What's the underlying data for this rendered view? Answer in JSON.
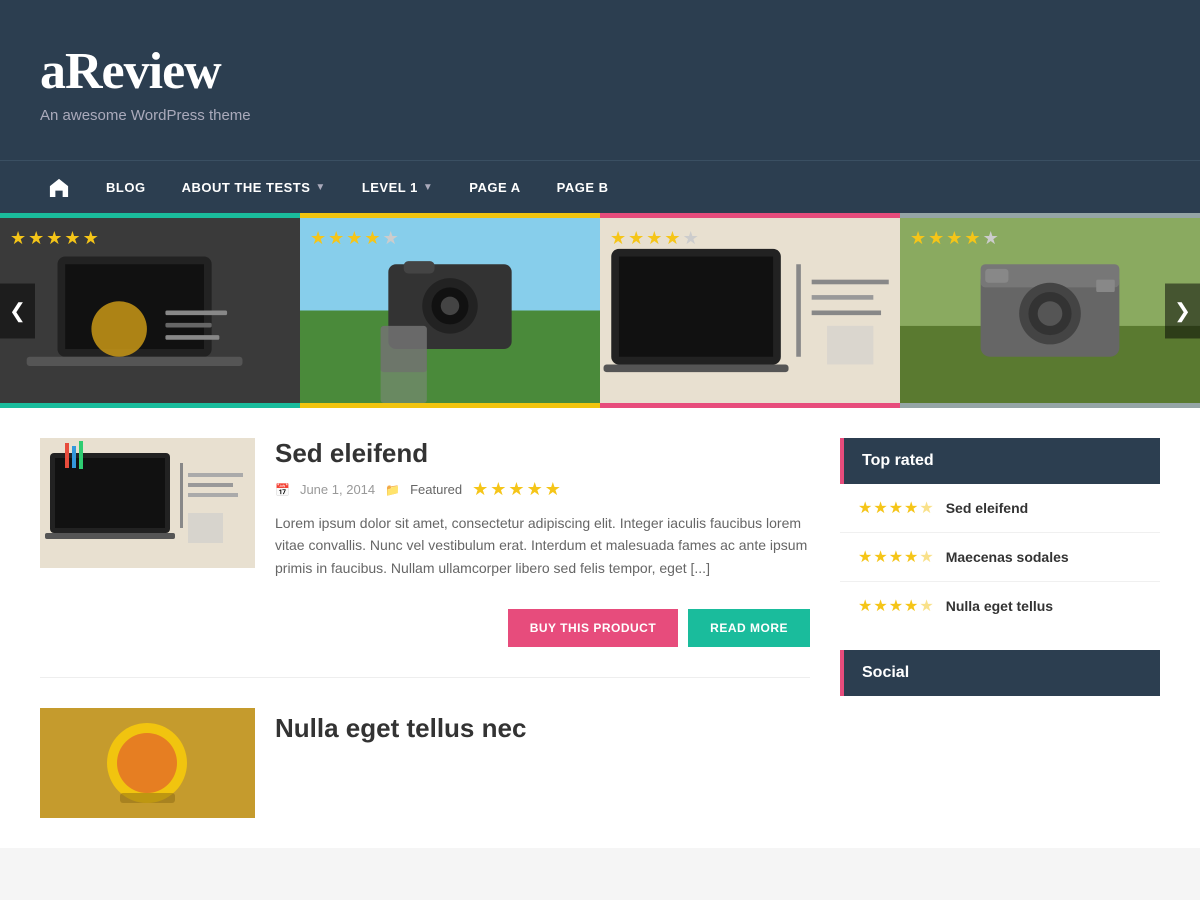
{
  "site": {
    "title": "aReview",
    "tagline": "An awesome WordPress theme"
  },
  "nav": {
    "home_label": "Home",
    "items": [
      {
        "id": "blog",
        "label": "BLOG",
        "has_dropdown": false
      },
      {
        "id": "about",
        "label": "ABOUT THE TESTS",
        "has_dropdown": true
      },
      {
        "id": "level1",
        "label": "LEVEL 1",
        "has_dropdown": true
      },
      {
        "id": "pagea",
        "label": "PAGE A",
        "has_dropdown": false
      },
      {
        "id": "pageb",
        "label": "PAGE B",
        "has_dropdown": false
      }
    ]
  },
  "carousel": {
    "prev_label": "❮",
    "next_label": "❯",
    "items": [
      {
        "id": "slide1",
        "stars": 4.5,
        "alt": "Laptop and coffee"
      },
      {
        "id": "slide2",
        "stars": 3.5,
        "alt": "Camera in hand"
      },
      {
        "id": "slide3",
        "stars": 3.5,
        "alt": "Desk workspace"
      },
      {
        "id": "slide4",
        "stars": 4.0,
        "alt": "Vintage camera"
      }
    ]
  },
  "posts": [
    {
      "id": "post1",
      "title": "Sed eleifend",
      "date": "June 1, 2014",
      "category": "Featured",
      "stars": 4.5,
      "excerpt": "Lorem ipsum dolor sit amet, consectetur adipiscing elit. Integer iaculis faucibus lorem vitae convallis. Nunc vel vestibulum erat. Interdum et malesuada fames ac ante ipsum primis in faucibus. Nullam ullamcorper libero sed felis tempor, eget [...]",
      "buy_label": "BUY THIS PRODUCT",
      "read_more_label": "READ MORE"
    },
    {
      "id": "post2",
      "title": "Nulla eget tellus nec",
      "date": "",
      "category": "",
      "stars": 0,
      "excerpt": ""
    }
  ],
  "sidebar": {
    "top_rated_title": "Top rated",
    "top_rated_items": [
      {
        "id": "tr1",
        "title": "Sed eleifend",
        "stars": 4.5
      },
      {
        "id": "tr2",
        "title": "Maecenas sodales",
        "stars": 4.5
      },
      {
        "id": "tr3",
        "title": "Nulla eget tellus",
        "stars": 4.5
      }
    ],
    "social_title": "Social"
  }
}
